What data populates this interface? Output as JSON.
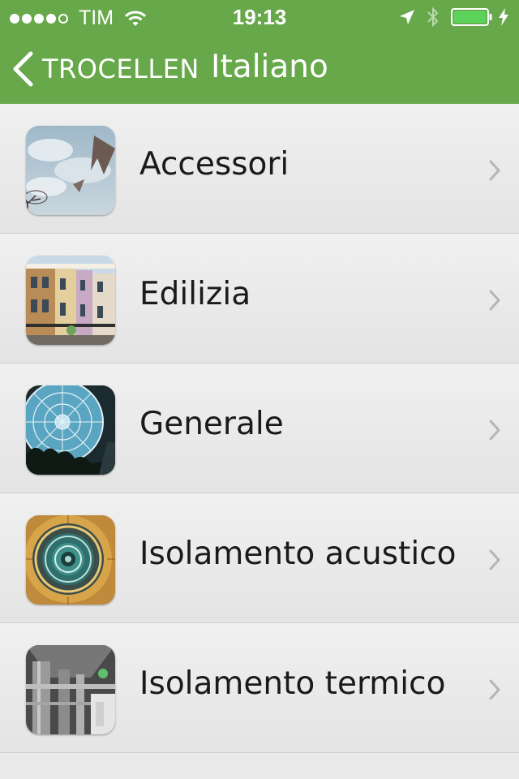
{
  "status_bar": {
    "carrier": "TIM",
    "time": "19:13",
    "signal_bars_filled": 4,
    "signal_bars_total": 5,
    "battery_level_percent": 100,
    "charging": true
  },
  "nav": {
    "back_label": "TROCELLEN",
    "title": "Italiano"
  },
  "colors": {
    "header_bg": "#67a84a",
    "header_text": "#ffffff",
    "battery_fill": "#5bd35b",
    "chevron": "#b5b5b5"
  },
  "icons": {
    "back": "chevron-left-icon",
    "disclosure": "chevron-right-icon",
    "wifi": "wifi-icon",
    "location": "location-arrow-icon",
    "bluetooth": "bluetooth-icon",
    "battery": "battery-icon",
    "charging": "bolt-icon"
  },
  "items": [
    {
      "label": "Accessori",
      "image": "sky-clouds-thumbnail"
    },
    {
      "label": "Edilizia",
      "image": "townhouses-thumbnail"
    },
    {
      "label": "Generale",
      "image": "glass-dome-thumbnail"
    },
    {
      "label": "Isolamento acustico",
      "image": "spiral-staircase-thumbnail"
    },
    {
      "label": "Isolamento termico",
      "image": "ceiling-ducts-thumbnail"
    }
  ]
}
